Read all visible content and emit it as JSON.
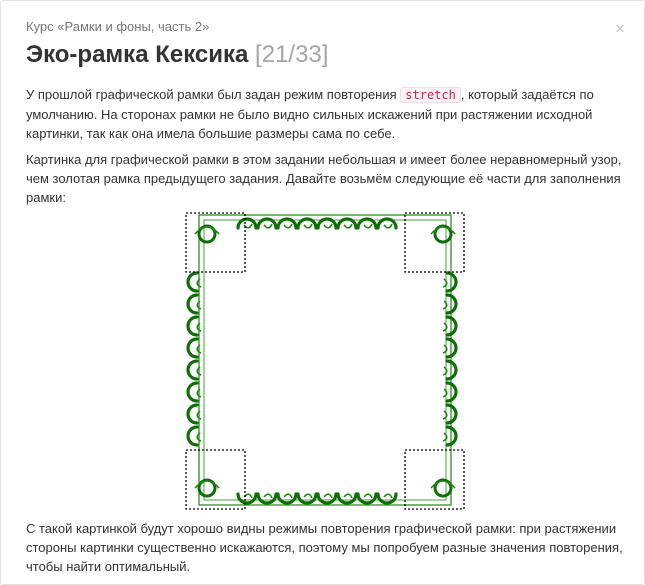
{
  "header": {
    "course_link": "Курс «Рамки и фоны, часть 2»",
    "close_symbol": "×"
  },
  "title": {
    "text": "Эко-рамка Кексика",
    "counter": "[21/33]"
  },
  "paragraphs": {
    "p1_before": "У прошлой графической рамки был задан режим повторения ",
    "p1_code": "stretch",
    "p1_after": ", который задаётся по умолчанию. На сторонах рамки не было видно сильных искажений при растяжении исходной картинки, так как она имела большие размеры сама по себе.",
    "p2": "Картинка для графической рамки в этом задании небольшая и имеет более неравномерный узор, чем золотая рамка предыдущего задания. Давайте возьмём следующие её части для заполнения рамки:",
    "p3": "С такой картинкой будут хорошо видны режимы повторения графической рамки: при растяжении стороны картинки существенно искажаются, поэтому мы попробуем разные значения повторения, чтобы найти оптимальный."
  },
  "colors": {
    "frame_green": "#1a8a0e",
    "frame_dark_green": "#0f6e06",
    "slice_outline": "#000000",
    "code_text": "#c7254e"
  },
  "icons": {
    "close": "close-icon",
    "figure": "green-ornamental-frame"
  }
}
